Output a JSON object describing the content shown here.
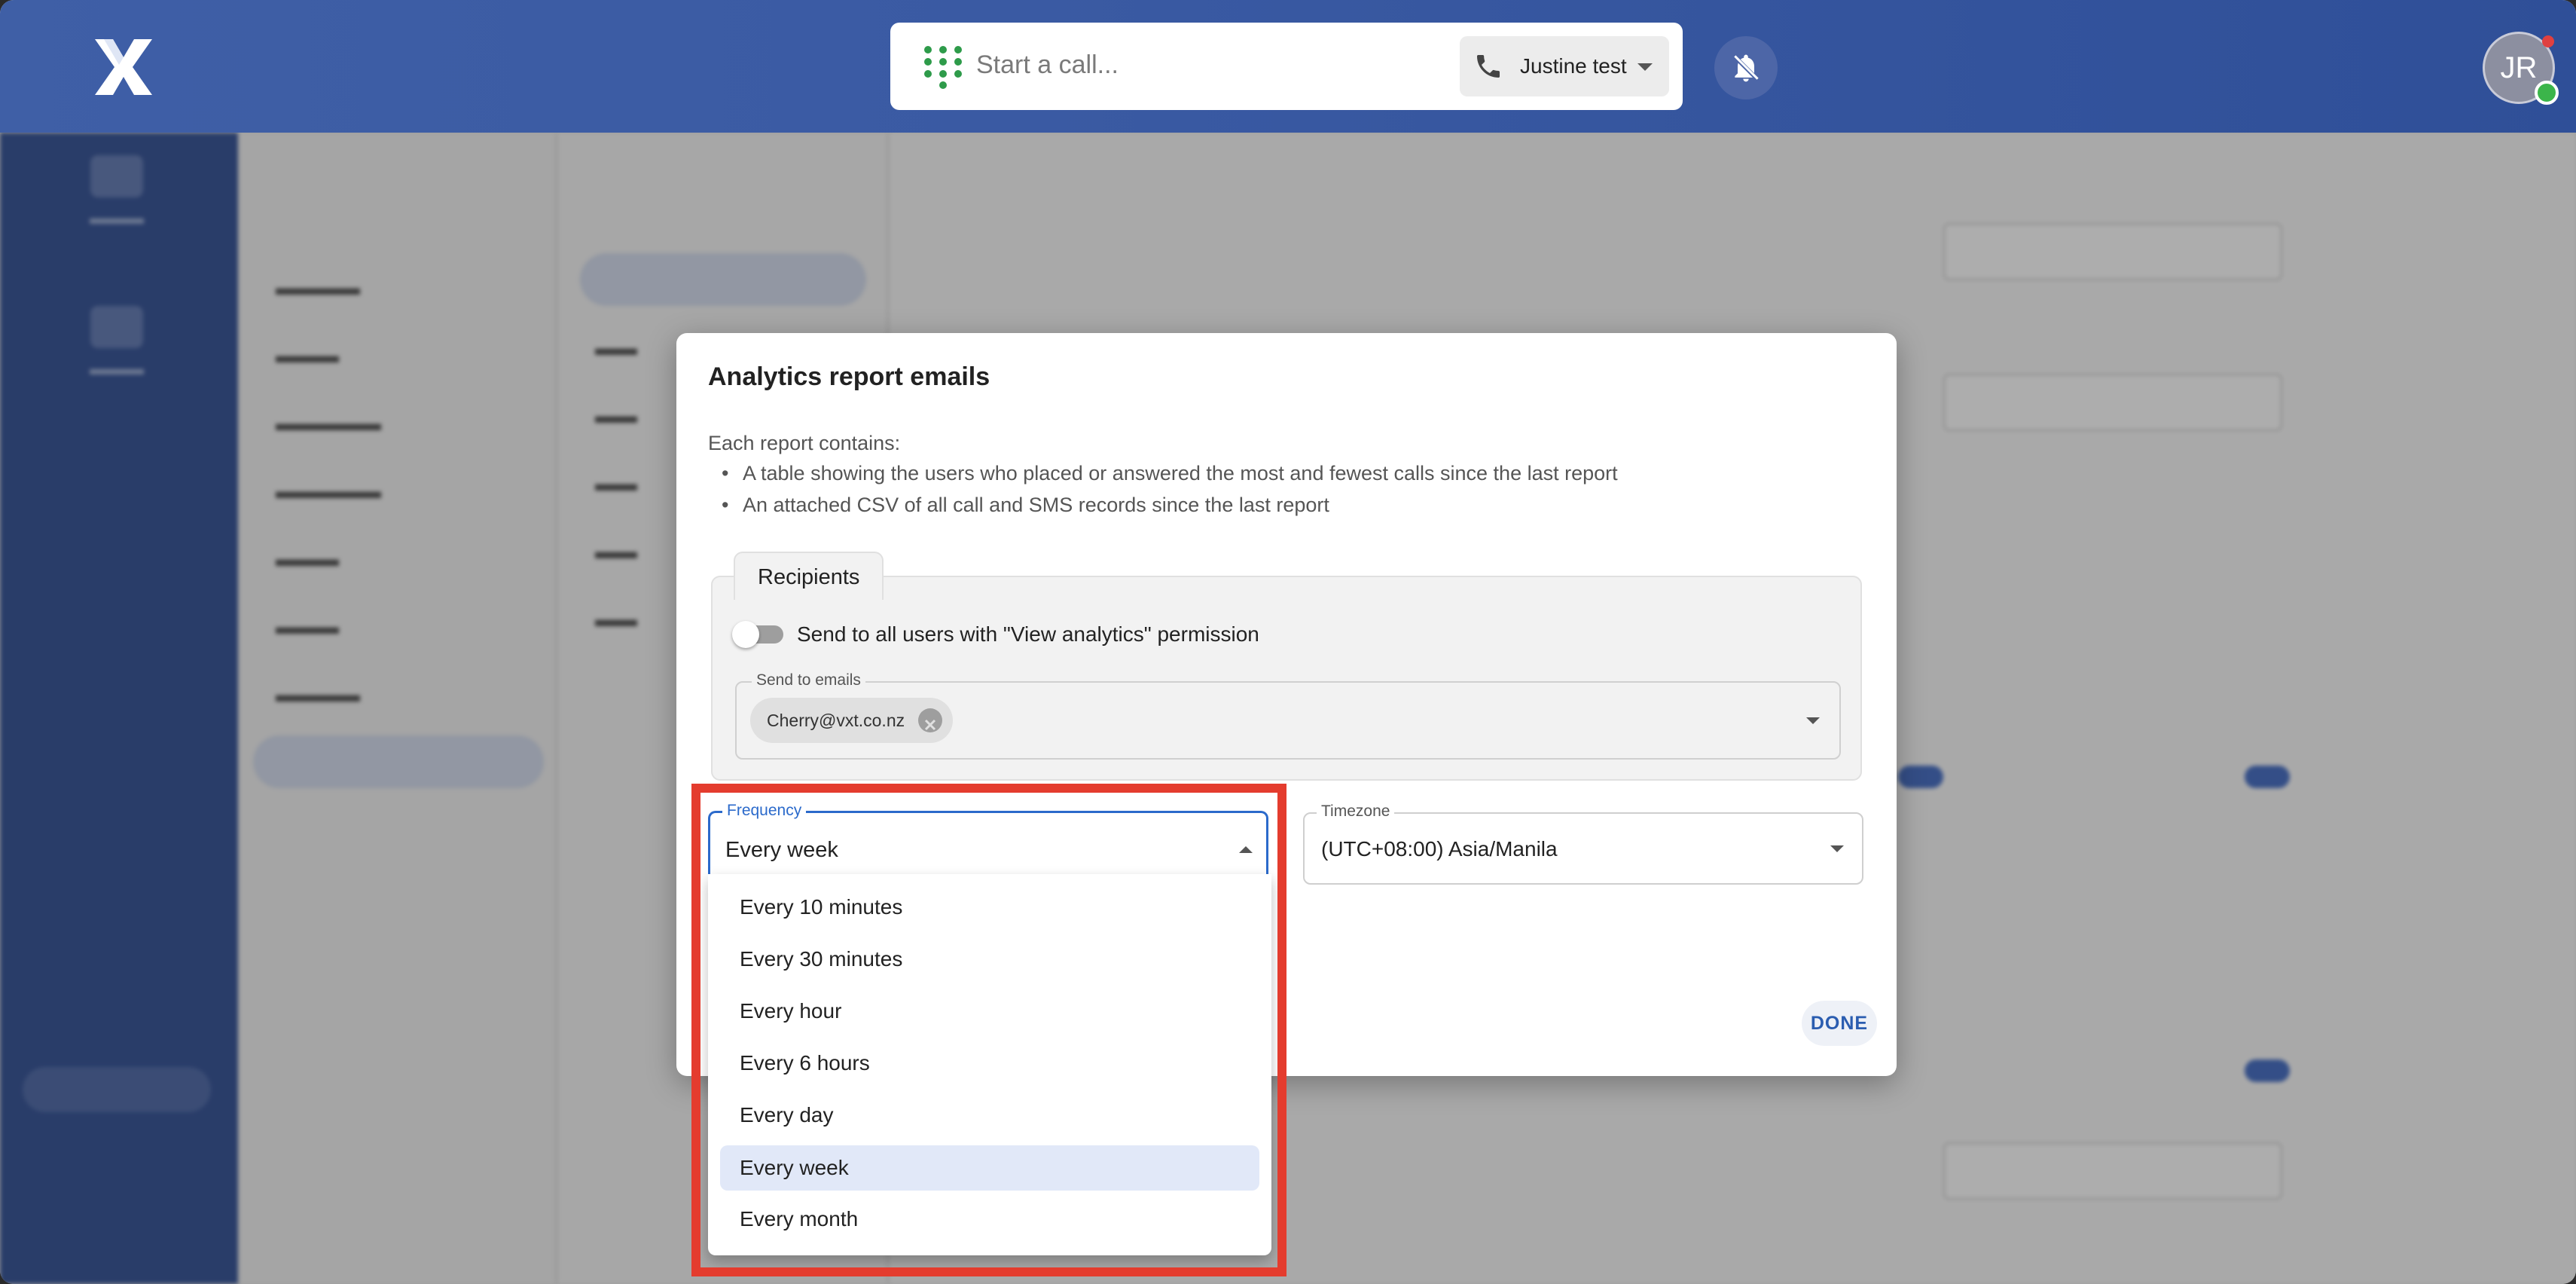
{
  "topbar": {
    "call_placeholder": "Start a call...",
    "line_name": "Justine test",
    "avatar_initials": "JR"
  },
  "dialog": {
    "title": "Analytics report emails",
    "intro": "Each report contains:",
    "bullets": [
      "A table showing the users who placed or answered the most and fewest calls since the last report",
      "An attached CSV of all call and SMS records since the last report"
    ],
    "recipients": {
      "tab_label": "Recipients",
      "toggle_label": "Send to all users with \"View analytics\" permission",
      "toggle_on": false,
      "emails_label": "Send to emails",
      "emails": [
        "Cherry@vxt.co.nz"
      ]
    },
    "frequency": {
      "label": "Frequency",
      "value": "Every week",
      "options": [
        "Every 10 minutes",
        "Every 30 minutes",
        "Every hour",
        "Every 6 hours",
        "Every day",
        "Every week",
        "Every month"
      ]
    },
    "timezone": {
      "label": "Timezone",
      "value": "(UTC+08:00) Asia/Manila"
    },
    "done_label": "DONE"
  },
  "colors": {
    "topbar": "#3a5aa3",
    "accent": "#2b6acb",
    "highlight": "#e43c2e",
    "selected_option": "#e1e8f8"
  }
}
